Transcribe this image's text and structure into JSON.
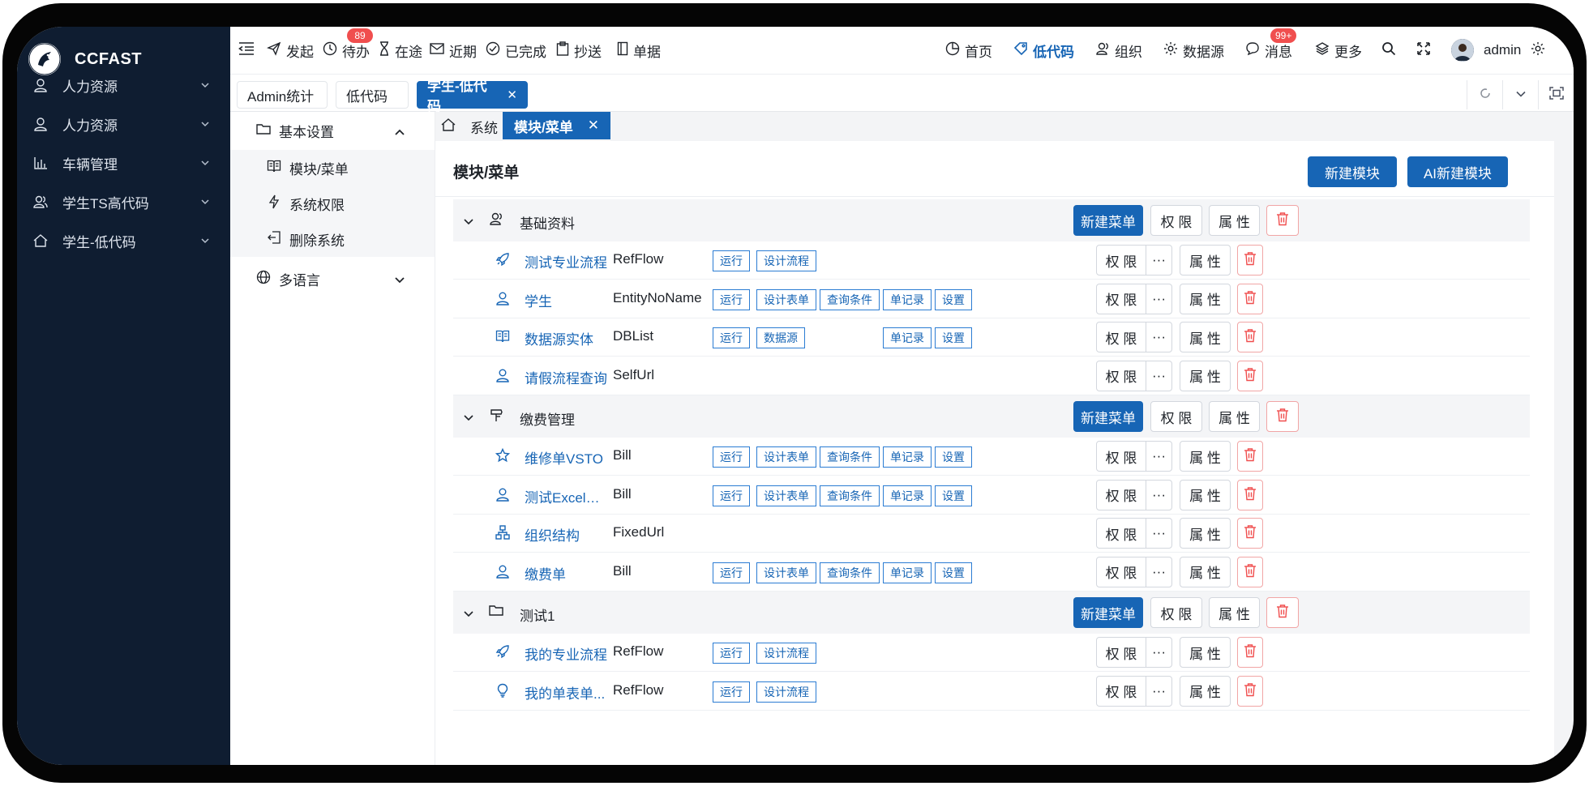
{
  "app": {
    "name": "CCFAST"
  },
  "sidebar": {
    "items": [
      {
        "label": "人力资源",
        "icon": "user-icon"
      },
      {
        "label": "人力资源",
        "icon": "user-icon"
      },
      {
        "label": "车辆管理",
        "icon": "chart-bars-icon"
      },
      {
        "label": "学生TS高代码",
        "icon": "user-group-icon"
      },
      {
        "label": "学生-低代码",
        "icon": "home-icon"
      }
    ]
  },
  "topbar": {
    "launch": "发起",
    "todo": "待办",
    "todo_badge": "89",
    "in_progress": "在途",
    "recent": "近期",
    "completed": "已完成",
    "cc": "抄送",
    "documents": "单据",
    "home": "首页",
    "lowcode": "低代码",
    "org": "组织",
    "datasource": "数据源",
    "messages": "消息",
    "messages_badge": "99+",
    "more": "更多",
    "username": "admin"
  },
  "tabs": [
    {
      "label": "Admin统计"
    },
    {
      "label": "低代码"
    },
    {
      "label": "学生-低代码",
      "active": true
    }
  ],
  "left_panel": {
    "group_basic": "基本设置",
    "sub_items": [
      {
        "label": "模块/菜单"
      },
      {
        "label": "系统权限"
      },
      {
        "label": "删除系统"
      }
    ],
    "group_lang": "多语言"
  },
  "breadcrumb": {
    "home": "系统",
    "active": "模块/菜单"
  },
  "main": {
    "title": "模块/菜单",
    "new_module": "新建模块",
    "ai_new_module": "AI新建模块",
    "new_menu": "新建菜单",
    "permission": "权 限",
    "properties": "属 性",
    "more": "···",
    "modules": [
      {
        "name": "基础资料",
        "icon": "user-group-icon",
        "rows": [
          {
            "name": "测试专业流程",
            "type": "RefFlow",
            "icon": "rocket-icon",
            "tags": [
              "运行",
              "设计流程"
            ]
          },
          {
            "name": "学生",
            "type": "EntityNoName",
            "icon": "user-icon",
            "tags": [
              "运行",
              "设计表单",
              "查询条件",
              "单记录",
              "设置"
            ]
          },
          {
            "name": "数据源实体",
            "type": "DBList",
            "icon": "book-icon",
            "tags": [
              "运行",
              "数据源",
              "单记录",
              "设置"
            ]
          },
          {
            "name": "请假流程查询",
            "type": "SelfUrl",
            "icon": "user-icon",
            "tags": []
          }
        ]
      },
      {
        "name": "缴费管理",
        "icon": "signpost-icon",
        "rows": [
          {
            "name": "维修单VSTO",
            "type": "Bill",
            "icon": "star-icon",
            "tags": [
              "运行",
              "设计表单",
              "查询条件",
              "单记录",
              "设置"
            ]
          },
          {
            "name": "测试Excel导...",
            "type": "Bill",
            "icon": "user-icon",
            "tags": [
              "运行",
              "设计表单",
              "查询条件",
              "单记录",
              "设置"
            ]
          },
          {
            "name": "组织结构",
            "type": "FixedUrl",
            "icon": "org-chart-icon",
            "tags": []
          },
          {
            "name": "缴费单",
            "type": "Bill",
            "icon": "user-icon",
            "tags": [
              "运行",
              "设计表单",
              "查询条件",
              "单记录",
              "设置"
            ]
          }
        ]
      },
      {
        "name": "测试1",
        "icon": "folder-icon",
        "rows": [
          {
            "name": "我的专业流程",
            "type": "RefFlow",
            "icon": "rocket-icon",
            "tags": [
              "运行",
              "设计流程"
            ]
          },
          {
            "name": "我的单表单...",
            "type": "RefFlow",
            "icon": "bulb-icon",
            "tags": [
              "运行",
              "设计流程"
            ]
          }
        ]
      }
    ]
  },
  "colors": {
    "primary": "#1765b5",
    "sidebar_bg": "#0f1d31",
    "danger": "#f04e4e"
  }
}
